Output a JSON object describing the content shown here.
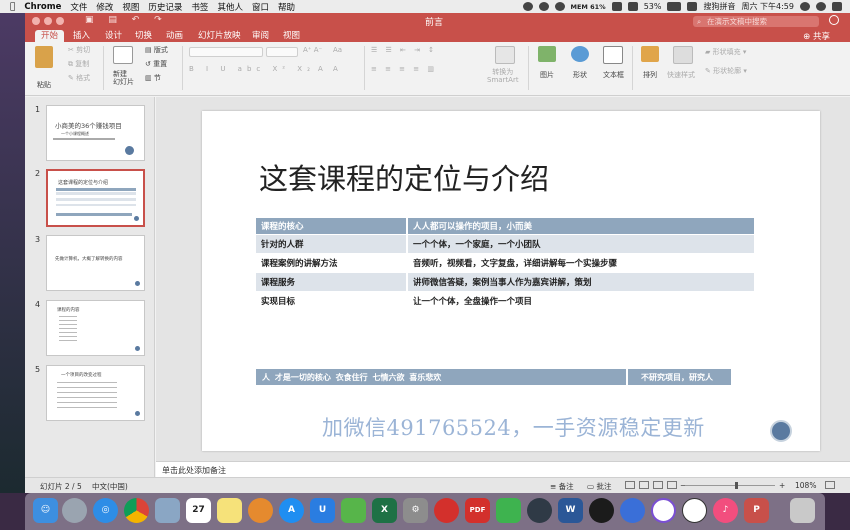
{
  "menubar": {
    "app": "Chrome",
    "items": [
      "文件",
      "修改",
      "视图",
      "历史记录",
      "书签",
      "其他人",
      "窗口",
      "帮助"
    ],
    "battery": "53%",
    "network": "MEM 61%",
    "ime": "搜狗拼音",
    "clock": "周六 下午4:59"
  },
  "window": {
    "title": "前言",
    "search_placeholder": "在演示文稿中搜索",
    "share": "共享"
  },
  "tabs": [
    "开始",
    "插入",
    "设计",
    "切换",
    "动画",
    "幻灯片放映",
    "审阅",
    "视图"
  ],
  "active_tab": "开始",
  "ribbon": {
    "paste": "粘贴",
    "cut": "剪切",
    "copy": "复制",
    "format": "格式",
    "new_slide": "新建\n幻灯片",
    "layout": "版式",
    "reset": "重置",
    "section": "节",
    "convert_smartart": "转换为\nSmartArt",
    "picture": "图片",
    "shape": "形状",
    "textbox": "文本框",
    "arrange": "排列",
    "quick_styles": "快速样式",
    "shape_fill": "形状填充",
    "shape_outline": "形状轮廓"
  },
  "thumbnails": [
    {
      "num": "1",
      "title": "小商美的36个赚钱项目",
      "sub": "一个小课程概述"
    },
    {
      "num": "2",
      "title": "这套课程的定位与介绍"
    },
    {
      "num": "3",
      "title": "先做计算机，大概了解转换的内容"
    },
    {
      "num": "4",
      "title": "课程的内容"
    },
    {
      "num": "5",
      "title": "一个项目的改变过程"
    }
  ],
  "slide": {
    "title": "这套课程的定位与介绍",
    "table": [
      [
        "课程的核心",
        "人人都可以操作的项目，小而美"
      ],
      [
        "针对的人群",
        "一个个体，一个家庭，一个小团队"
      ],
      [
        "课程案例的讲解方法",
        "音频听，视频看，文字复盘，详细讲解每一个实操步骤"
      ],
      [
        "课程服务",
        "讲师微信答疑，案例当事人作为嘉宾讲解，策划"
      ],
      [
        "实现目标",
        "让一个个体，全盘操作一个项目"
      ]
    ],
    "bar_left": "人 才是一切的核心 衣食住行 七情六欲 喜乐悲欢",
    "bar_right": "不研究项目，研究人",
    "watermark": "加微信491765524，一手资源稳定更新"
  },
  "notes_placeholder": "单击此处添加备注",
  "status": {
    "slide_counter": "幻灯片 2 / 5",
    "language": "中文(中国)",
    "notes_btn": "备注",
    "comments_btn": "批注",
    "zoom": "108%"
  },
  "dock_apps": [
    "finder",
    "launchpad",
    "safari",
    "chrome",
    "preview",
    "calendar",
    "notes",
    "books",
    "app-store",
    "utools",
    "evernote",
    "excel",
    "system-preferences",
    "netease-music",
    "pdf-expert",
    "wechat",
    "quicktime",
    "word",
    "qq",
    "baidu-netdisk",
    "omnifocus",
    "soccer",
    "itunes",
    "powerpoint",
    "trash"
  ],
  "colors": {
    "accent": "#c8504a",
    "table_header": "#8fa6bd",
    "table_alt": "#dde3ea",
    "watermark": "#9bb4d6"
  }
}
